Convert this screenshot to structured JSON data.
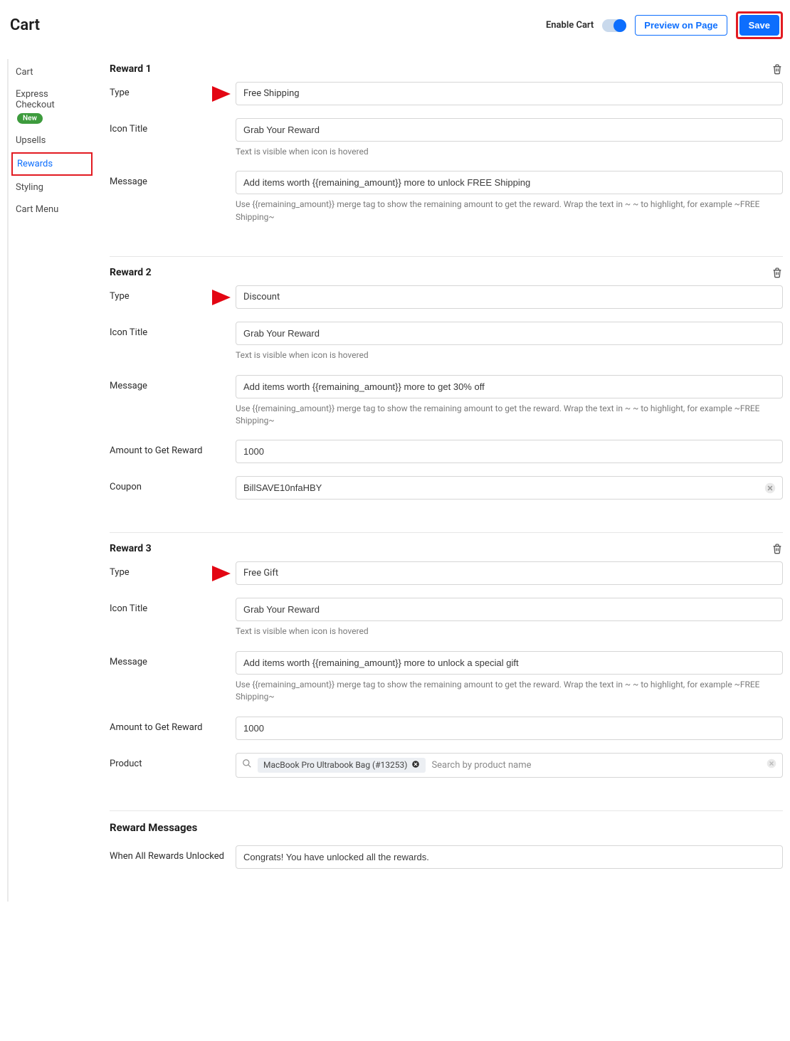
{
  "topbar": {
    "title": "Cart",
    "enable_cart_label": "Enable Cart",
    "preview_label": "Preview on Page",
    "save_label": "Save"
  },
  "sidebar": {
    "items": [
      {
        "label": "Cart"
      },
      {
        "label": "Express Checkout",
        "badge": "New"
      },
      {
        "label": "Upsells"
      },
      {
        "label": "Rewards"
      },
      {
        "label": "Styling"
      },
      {
        "label": "Cart Menu"
      }
    ]
  },
  "rewards": [
    {
      "title": "Reward 1",
      "type_label": "Type",
      "type_value": "Free Shipping",
      "icon_title_label": "Icon Title",
      "icon_title_value": "Grab Your Reward",
      "icon_hint": "Text is visible when icon is hovered",
      "message_label": "Message",
      "message_value": "Add items worth {{remaining_amount}} more to unlock FREE Shipping",
      "message_hint": "Use {{remaining_amount}} merge tag to show the remaining amount to get the reward. Wrap the text in ~ ~ to highlight, for example ~FREE Shipping~"
    },
    {
      "title": "Reward 2",
      "type_label": "Type",
      "type_value": "Discount",
      "icon_title_label": "Icon Title",
      "icon_title_value": "Grab Your Reward",
      "icon_hint": "Text is visible when icon is hovered",
      "message_label": "Message",
      "message_value": "Add items worth {{remaining_amount}} more to get 30% off",
      "message_hint": "Use {{remaining_amount}} merge tag to show the remaining amount to get the reward. Wrap the text in ~ ~ to highlight, for example ~FREE Shipping~",
      "amount_label": "Amount to Get Reward",
      "amount_value": "1000",
      "coupon_label": "Coupon",
      "coupon_value": "BillSAVE10nfaHBY"
    },
    {
      "title": "Reward 3",
      "type_label": "Type",
      "type_value": "Free Gift",
      "icon_title_label": "Icon Title",
      "icon_title_value": "Grab Your Reward",
      "icon_hint": "Text is visible when icon is hovered",
      "message_label": "Message",
      "message_value": "Add items worth {{remaining_amount}} more to unlock a special gift",
      "message_hint": "Use {{remaining_amount}} merge tag to show the remaining amount to get the reward. Wrap the text in ~ ~ to highlight, for example ~FREE Shipping~",
      "amount_label": "Amount to Get Reward",
      "amount_value": "1000",
      "product_label": "Product",
      "product_chip": "MacBook Pro Ultrabook Bag (#13253)",
      "product_placeholder": "Search by product name"
    }
  ],
  "reward_messages": {
    "section_title": "Reward Messages",
    "when_all_label": "When All Rewards Unlocked",
    "when_all_value": "Congrats! You have unlocked all the rewards."
  }
}
